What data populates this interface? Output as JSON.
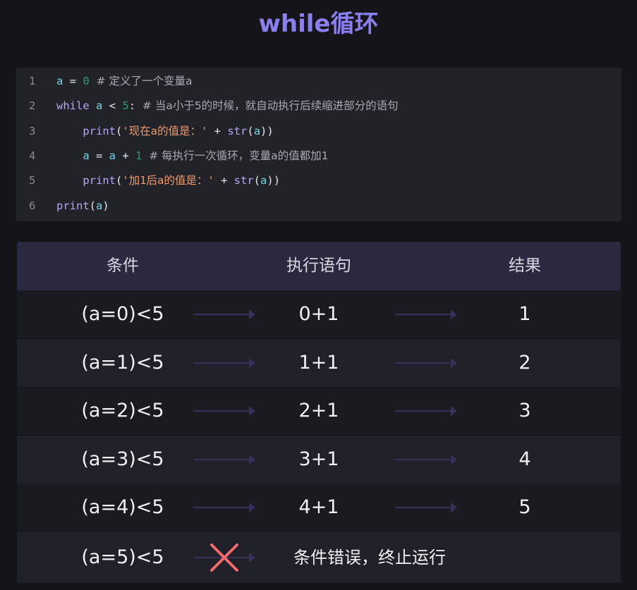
{
  "title": "while循环",
  "code": {
    "lines": [
      {
        "num": "1",
        "tokens": [
          {
            "t": "a",
            "c": "var"
          },
          {
            "t": " = ",
            "c": "op"
          },
          {
            "t": "0",
            "c": "num"
          },
          {
            "t": "  # 定义了一个变量a",
            "c": "cm"
          }
        ]
      },
      {
        "num": "2",
        "tokens": [
          {
            "t": "while",
            "c": "kw"
          },
          {
            "t": " ",
            "c": "op"
          },
          {
            "t": "a",
            "c": "var"
          },
          {
            "t": " < ",
            "c": "op"
          },
          {
            "t": "5",
            "c": "num"
          },
          {
            "t": ":",
            "c": "op"
          },
          {
            "t": "  # 当a小于5的时候，就自动执行后续缩进部分的语句",
            "c": "cm"
          }
        ]
      },
      {
        "num": "3",
        "tokens": [
          {
            "t": "    print",
            "c": "fn"
          },
          {
            "t": "(",
            "c": "op"
          },
          {
            "t": "'现在a的值是：'",
            "c": "str"
          },
          {
            "t": " + ",
            "c": "op"
          },
          {
            "t": "str",
            "c": "fn"
          },
          {
            "t": "(",
            "c": "op"
          },
          {
            "t": "a",
            "c": "var"
          },
          {
            "t": "))",
            "c": "op"
          }
        ]
      },
      {
        "num": "4",
        "tokens": [
          {
            "t": "    a",
            "c": "var"
          },
          {
            "t": " = ",
            "c": "op"
          },
          {
            "t": "a",
            "c": "var"
          },
          {
            "t": " + ",
            "c": "op"
          },
          {
            "t": "1",
            "c": "num"
          },
          {
            "t": "  # 每执行一次循环，变量a的值都加1",
            "c": "cm"
          }
        ]
      },
      {
        "num": "5",
        "tokens": [
          {
            "t": "    print",
            "c": "fn"
          },
          {
            "t": "(",
            "c": "op"
          },
          {
            "t": "'加1后a的值是：'",
            "c": "str"
          },
          {
            "t": " + ",
            "c": "op"
          },
          {
            "t": "str",
            "c": "fn"
          },
          {
            "t": "(",
            "c": "op"
          },
          {
            "t": "a",
            "c": "var"
          },
          {
            "t": "))",
            "c": "op"
          }
        ]
      },
      {
        "num": "6",
        "tokens": [
          {
            "t": "print",
            "c": "fn"
          },
          {
            "t": "(",
            "c": "op"
          },
          {
            "t": "a",
            "c": "var"
          },
          {
            "t": ")",
            "c": "op"
          }
        ]
      }
    ]
  },
  "table": {
    "headers": [
      "条件",
      "执行语句",
      "结果"
    ],
    "rows": [
      {
        "cond": "(a=0)<5",
        "stmt": "0+1",
        "result": "1"
      },
      {
        "cond": "(a=1)<5",
        "stmt": "1+1",
        "result": "2"
      },
      {
        "cond": "(a=2)<5",
        "stmt": "2+1",
        "result": "3"
      },
      {
        "cond": "(a=3)<5",
        "stmt": "3+1",
        "result": "4"
      },
      {
        "cond": "(a=4)<5",
        "stmt": "4+1",
        "result": "5"
      }
    ],
    "final": {
      "cond": "(a=5)<5",
      "message": "条件错误，终止运行"
    }
  },
  "colors": {
    "accent": "#8b7ff0",
    "cross": "#f06b6b"
  }
}
